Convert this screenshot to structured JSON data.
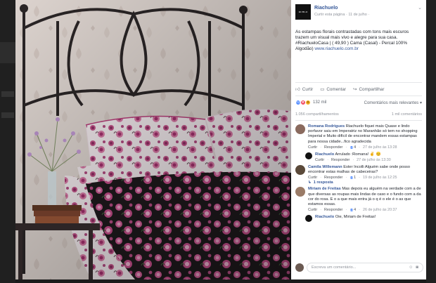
{
  "page": {
    "name": "Riachuelo",
    "avatar_text": "RCHLO",
    "meta_prefix": "Curtir esta página",
    "meta_sep": "·",
    "date": "11 de julho",
    "meta_suffix": "·",
    "options_icon": "chevron-down-icon"
  },
  "post": {
    "text": "As estampas florais contrastadas com tons mais escuros trazem um visual mais vivo e alegre para sua casa. #RiachueloCasa | ( 49,90 ) Cama (Casal) - Percal 100% Algodão)",
    "link": "www.riachuelo.com.br"
  },
  "actions": {
    "like": "Curtir",
    "comment": "Comentar",
    "share": "Compartilhar"
  },
  "reactions": {
    "count": "132 mil",
    "relevance": "Comentários mais relevantes ▾",
    "icons": [
      "like-icon",
      "love-icon",
      "wow-icon"
    ]
  },
  "stats": {
    "shares": "1.056 compartilhamentos",
    "comments": "1 mil comentários"
  },
  "comments": [
    {
      "name": "Romana Rodrigues",
      "text": "Riachuelo fiquei mais Quase e lindo porfavor saiu em Imperatriz no Maranhão só tem no shopping Imperial e Muito difícil de encontrar mandem essas estampas para nossa cidade...fico agradecida",
      "like": "Curtir",
      "reply": "Responder",
      "likes": "4",
      "time": "27 de julho às 13:28"
    },
    {
      "name": "Riachuelo",
      "text": "Arrulado :Romana! ✌️ 😊",
      "like": "Curtir",
      "reply": "Responder",
      "time": "27 de julho às 13:30",
      "is_reply": true
    },
    {
      "name": "Camila Willemann",
      "text": "Ester Incolli Alguém sabe onde posso encontrar estas malhas de cabeceiras?",
      "like": "Curtir",
      "reply": "Responder",
      "likes": "1",
      "time": "19 de julho às 12:25",
      "replies": "1 resposta"
    },
    {
      "name": "Miriam de Freitas",
      "text": "Mas depois eu alguém na verdade com a de que diversas as roupas mais lindas de caso e o fundo com a da cor do rosa. E o a que mais entra já o q é o ele é o as que estamos essas.",
      "like": "Curtir",
      "reply": "Responder",
      "likes": "4",
      "time": "26 de julho às 20:37"
    },
    {
      "name": "Riachuelo",
      "text": "Oie, Miriam de Freitas!",
      "is_reply": true
    }
  ],
  "composer": {
    "placeholder": "Escreva um comentário...",
    "icons": [
      "emoji-icon",
      "camera-icon"
    ]
  },
  "colors": {
    "facebook_blue": "#365899",
    "like_blue": "#5890ff",
    "love_red": "#f25268",
    "wow_yellow": "#f7b125"
  }
}
